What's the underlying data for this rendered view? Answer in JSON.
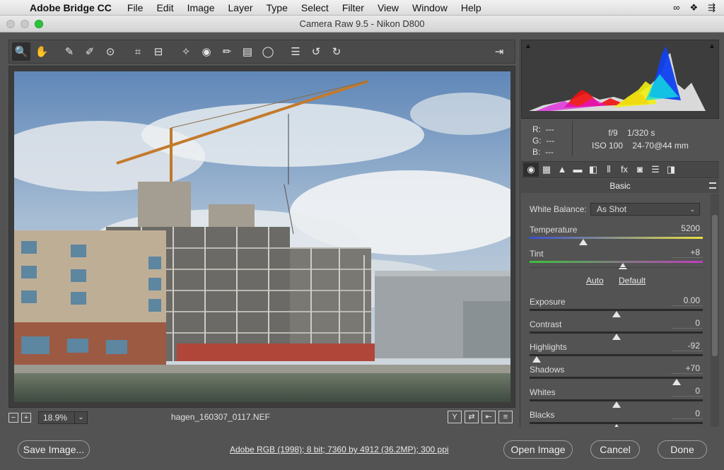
{
  "menubar": {
    "apple": "",
    "app_name": "Adobe Bridge CC",
    "menus": [
      "File",
      "Edit",
      "Image",
      "Layer",
      "Type",
      "Select",
      "Filter",
      "View",
      "Window",
      "Help"
    ],
    "status_icons": [
      "creative-cloud-icon",
      "dropbox-icon",
      "arrows-icon"
    ]
  },
  "window": {
    "title": "Camera Raw 9.5  -  Nikon D800"
  },
  "toolbar": {
    "tools": [
      {
        "name": "zoom-tool-icon",
        "glyph": "🔍",
        "selected": true
      },
      {
        "name": "hand-tool-icon",
        "glyph": "✋"
      },
      {
        "name": "white-balance-tool-icon",
        "glyph": "✎"
      },
      {
        "name": "color-sampler-tool-icon",
        "glyph": "✐"
      },
      {
        "name": "targeted-adjustment-tool-icon",
        "glyph": "⊙"
      },
      {
        "name": "crop-tool-icon",
        "glyph": "⌗"
      },
      {
        "name": "straighten-tool-icon",
        "glyph": "⊟"
      },
      {
        "name": "spot-removal-tool-icon",
        "glyph": "✧"
      },
      {
        "name": "red-eye-tool-icon",
        "glyph": "◉"
      },
      {
        "name": "adjustment-brush-icon",
        "glyph": "✏"
      },
      {
        "name": "graduated-filter-icon",
        "glyph": "▤"
      },
      {
        "name": "radial-filter-icon",
        "glyph": "◯"
      },
      {
        "name": "preferences-icon",
        "glyph": "☰"
      },
      {
        "name": "rotate-left-icon",
        "glyph": "↺"
      },
      {
        "name": "rotate-right-icon",
        "glyph": "↻"
      }
    ],
    "export_icon": "⇥"
  },
  "status": {
    "zoom": "18.9%",
    "filename": "hagen_160307_0117.NEF",
    "view_buttons": [
      "Y",
      "⇄",
      "⇤",
      "≡"
    ]
  },
  "info": {
    "r_label": "R:",
    "r_value": "---",
    "g_label": "G:",
    "g_value": "---",
    "b_label": "B:",
    "b_value": "---",
    "aperture": "f/9",
    "shutter": "1/320 s",
    "iso": "ISO 100",
    "lens": "24-70@44 mm"
  },
  "panel": {
    "tab_icons": [
      "◉",
      "▦",
      "▲",
      "▬",
      "◧",
      "⫴",
      "fx",
      "◙",
      "☰",
      "◨"
    ],
    "title": "Basic",
    "white_balance_label": "White Balance:",
    "white_balance_value": "As Shot",
    "auto_label": "Auto",
    "default_label": "Default",
    "sliders": [
      {
        "label": "Temperature",
        "value": "5200",
        "fraction": 0.31,
        "style": "temp"
      },
      {
        "label": "Tint",
        "value": "+8",
        "fraction": 0.54,
        "style": "tint"
      },
      {
        "label": "Exposure",
        "value": "0.00",
        "fraction": 0.5
      },
      {
        "label": "Contrast",
        "value": "0",
        "fraction": 0.5
      },
      {
        "label": "Highlights",
        "value": "-92",
        "fraction": 0.04
      },
      {
        "label": "Shadows",
        "value": "+70",
        "fraction": 0.85
      },
      {
        "label": "Whites",
        "value": "0",
        "fraction": 0.5
      },
      {
        "label": "Blacks",
        "value": "0",
        "fraction": 0.5
      }
    ]
  },
  "footer": {
    "save_label": "Save Image...",
    "workflow": "Adobe RGB (1998); 8 bit; 7360 by 4912 (36.2MP); 300 ppi",
    "open_label": "Open Image",
    "cancel_label": "Cancel",
    "done_label": "Done"
  }
}
